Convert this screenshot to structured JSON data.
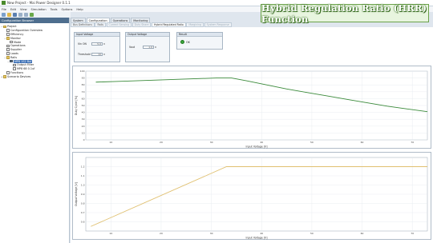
{
  "window": {
    "title": "New Project - Mai Power Designer 0.1.1"
  },
  "menu": [
    "File",
    "Edit",
    "View",
    "Simulation",
    "Tools",
    "Options",
    "Help"
  ],
  "left_panel": {
    "header": "Configuration Browser",
    "tree": [
      {
        "label": "Project",
        "level": 0,
        "icon": "folder-icon",
        "exp": "−"
      },
      {
        "label": "Configuration Overview",
        "level": 1,
        "icon": "doc-icon",
        "exp": ""
      },
      {
        "label": "Efficiency",
        "level": 1,
        "icon": "doc-icon",
        "exp": ""
      },
      {
        "label": "Monitor",
        "level": 1,
        "icon": "folder-icon",
        "exp": "−"
      },
      {
        "label": "Mode",
        "level": 2,
        "icon": "doc-icon",
        "exp": ""
      },
      {
        "label": "Operations",
        "level": 1,
        "icon": "doc-icon",
        "exp": ""
      },
      {
        "label": "Supplier",
        "level": 1,
        "icon": "doc-icon",
        "exp": ""
      },
      {
        "label": "Loads",
        "level": 1,
        "icon": "doc-icon",
        "exp": ""
      },
      {
        "label": "Rails",
        "level": 1,
        "icon": "folder-icon",
        "exp": "−"
      },
      {
        "label": "MP8 1S2 Buf",
        "level": 2,
        "icon": "chip-icon",
        "exp": "−",
        "selected": true
      },
      {
        "label": "Output Filter",
        "level": 3,
        "icon": "doc-icon",
        "exp": ""
      },
      {
        "label": "MP8 68 0.1uf",
        "level": 3,
        "icon": "doc-icon",
        "exp": ""
      },
      {
        "label": "Functions",
        "level": 1,
        "icon": "doc-icon",
        "exp": ""
      },
      {
        "label": "Scenario Devices",
        "level": 0,
        "icon": "folder-icon",
        "exp": "+"
      }
    ]
  },
  "top_tabs": [
    {
      "label": "System",
      "active": false
    },
    {
      "label": "Configuration",
      "active": true
    },
    {
      "label": "Operations",
      "active": false
    },
    {
      "label": "Monitoring",
      "active": false
    }
  ],
  "sub_tabs": [
    {
      "label": "Bus Definitions",
      "state": ""
    },
    {
      "label": "Rails",
      "state": ""
    },
    {
      "label": "Current Sensing",
      "state": "dim"
    },
    {
      "label": "Duty Share",
      "state": "dim"
    },
    {
      "label": "Hybrid Regulated Ratio",
      "state": "active"
    },
    {
      "label": "Margining",
      "state": "dim"
    },
    {
      "label": "System Response",
      "state": "dim"
    }
  ],
  "banner": {
    "text": "Hybrid Regulation Ratio (HRR) Function"
  },
  "input_voltage": {
    "title": "Input Voltage",
    "vin_label": "Vin ON",
    "vin_value": "5.0",
    "vin_unit": "V",
    "thr_label": "Threshold",
    "thr_value": "10",
    "thr_unit": "V"
  },
  "output_voltage": {
    "title": "Output Voltage",
    "label": "Vout",
    "value": "1.0",
    "unit": "V"
  },
  "result": {
    "title": "Result",
    "status": "OK"
  },
  "colors": {
    "duty_line": "#3a8a3a",
    "vout_line": "#e0c070"
  },
  "chart_data": [
    {
      "type": "line",
      "title": "",
      "xlabel": "Input Voltage [V]",
      "ylabel": "Duty Cycle [%]",
      "xlim": [
        5,
        73
      ],
      "ylim": [
        0,
        100
      ],
      "xticks": [
        10,
        20,
        30,
        40,
        50,
        60,
        70
      ],
      "yticks": [
        0,
        10,
        20,
        30,
        40,
        50,
        60,
        70,
        80,
        90,
        100
      ],
      "x": [
        7,
        11,
        15,
        19,
        23,
        27,
        31,
        33,
        34,
        37,
        41,
        45,
        49,
        53,
        57,
        61,
        65,
        69,
        73
      ],
      "series": [
        {
          "values": [
            84,
            85,
            86,
            87,
            88,
            89,
            90,
            90,
            90,
            86,
            80,
            74,
            69,
            64,
            59,
            54,
            49,
            45,
            41
          ]
        }
      ],
      "note_x_shape": "decreasing after 33"
    },
    {
      "type": "line",
      "title": "",
      "xlabel": "Input Voltage [V]",
      "ylabel": "Output Voltage [V]",
      "xlim": [
        5,
        73
      ],
      "ylim": [
        0.5,
        1.3
      ],
      "xticks": [
        10,
        20,
        30,
        40,
        50,
        60,
        70
      ],
      "yticks": [
        0.6,
        0.7,
        0.8,
        0.9,
        1.0,
        1.1,
        1.2
      ],
      "x": [
        6,
        33,
        73
      ],
      "series": [
        {
          "values": [
            0.55,
            1.2,
            1.2
          ]
        }
      ]
    }
  ]
}
